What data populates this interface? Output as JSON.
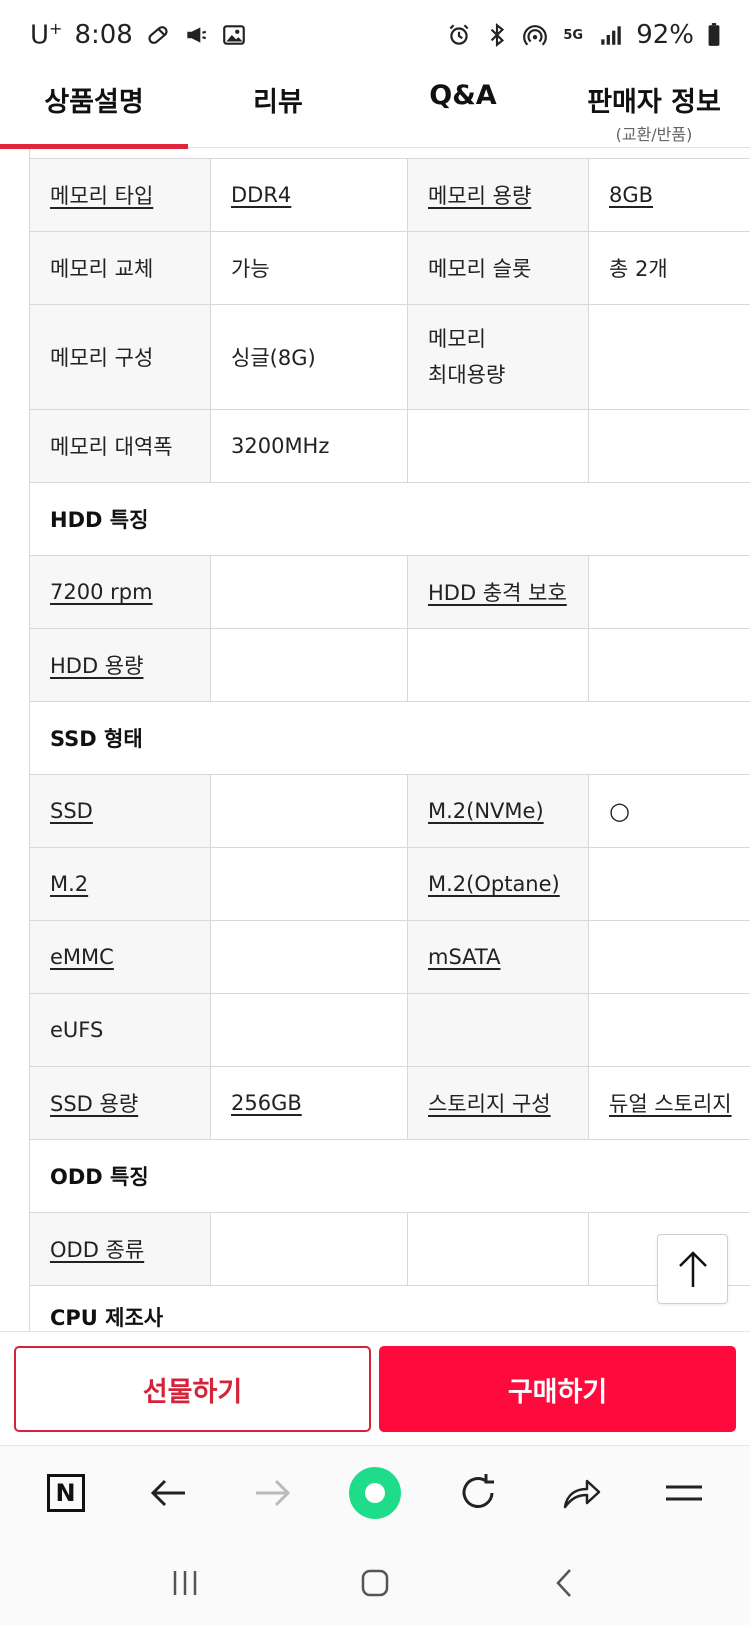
{
  "status_bar": {
    "carrier": "U",
    "carrier_sup": "+",
    "time": "8:08",
    "network": "5G",
    "battery": "92%"
  },
  "tabs": [
    {
      "label": "상품설명",
      "active": true
    },
    {
      "label": "리뷰"
    },
    {
      "label": "Q&A"
    },
    {
      "label": "판매자 정보",
      "sub": "(교환/반품)"
    }
  ],
  "spec_table": {
    "rows": [
      {
        "c1": "메모리 타입",
        "c2": "DDR4",
        "c3": "메모리 용량",
        "c4": "8GB"
      },
      {
        "c1": "메모리 교체",
        "c2": "가능",
        "c3": "메모리 슬롯",
        "c4": "총 2개"
      },
      {
        "c1": "메모리 구성",
        "c2": "싱글(8G)",
        "c3": "메모리\n최대용량",
        "c4": ""
      },
      {
        "c1": "메모리 대역폭",
        "c2": "3200MHz",
        "c3": "",
        "c4": ""
      },
      {
        "section": "HDD 특징"
      },
      {
        "c1": "7200 rpm",
        "c2": "",
        "c3": "HDD 충격 보호",
        "c4": ""
      },
      {
        "c1": "HDD 용량",
        "c2": "",
        "c3": "",
        "c4": ""
      },
      {
        "section": "SSD 형태"
      },
      {
        "c1": "SSD",
        "c2": "",
        "c3": "M.2(NVMe)",
        "c4": "○"
      },
      {
        "c1": "M.2",
        "c2": "",
        "c3": "M.2(Optane)",
        "c4": ""
      },
      {
        "c1": "eMMC",
        "c2": "",
        "c3": "mSATA",
        "c4": ""
      },
      {
        "c1": "eUFS",
        "c2": "",
        "c3": "",
        "c4": ""
      },
      {
        "c1": "SSD 용량",
        "c2": "256GB",
        "c3": "스토리지 구성",
        "c4": "듀얼 스토리지"
      },
      {
        "section": "ODD 특징"
      },
      {
        "c1": "ODD 종류",
        "c2": "",
        "c3": "",
        "c4": ""
      },
      {
        "section": "CPU 제조사"
      }
    ]
  },
  "buy_bar": {
    "gift_label": "선물하기",
    "buy_label": "구매하기"
  },
  "browser_bar": {
    "n_label": "N"
  },
  "colors": {
    "accent_red": "#e0263a",
    "buy_red": "#ff0a3c",
    "browser_green": "#1fdc8a"
  }
}
